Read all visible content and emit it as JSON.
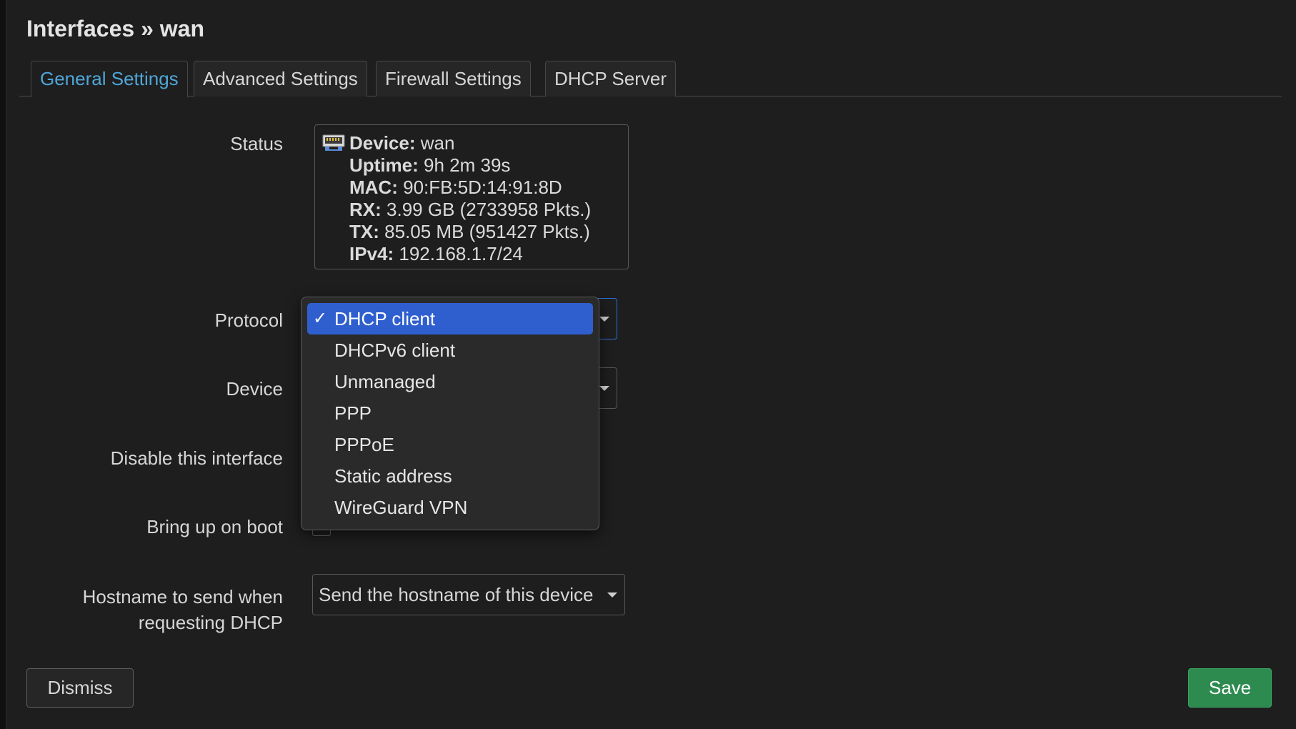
{
  "dialog": {
    "title": "Interfaces » wan"
  },
  "tabs": [
    {
      "label": "General Settings",
      "active": true
    },
    {
      "label": "Advanced Settings",
      "active": false
    },
    {
      "label": "Firewall Settings",
      "active": false
    },
    {
      "label": "DHCP Server",
      "active": false
    }
  ],
  "status": {
    "label": "Status",
    "icon": "ethernet-port-icon",
    "lines": [
      {
        "key": "Device:",
        "value": "wan"
      },
      {
        "key": "Uptime:",
        "value": "9h 2m 39s"
      },
      {
        "key": "MAC:",
        "value": "90:FB:5D:14:91:8D"
      },
      {
        "key": "RX:",
        "value": "3.99 GB (2733958 Pkts.)"
      },
      {
        "key": "TX:",
        "value": "85.05 MB (951427 Pkts.)"
      },
      {
        "key": "IPv4:",
        "value": "192.168.1.7/24"
      }
    ]
  },
  "protocol": {
    "label": "Protocol",
    "selected": "DHCP client",
    "options": [
      "DHCP client",
      "DHCPv6 client",
      "Unmanaged",
      "PPP",
      "PPPoE",
      "Static address",
      "WireGuard VPN"
    ],
    "check_mark": "✓"
  },
  "device": {
    "label": "Device"
  },
  "disable_interface": {
    "label": "Disable this interface"
  },
  "bring_up_on_boot": {
    "label": "Bring up on boot"
  },
  "hostname": {
    "label_line1": "Hostname to send when",
    "label_line2": "requesting DHCP",
    "value": "Send the hostname of this device"
  },
  "buttons": {
    "dismiss": "Dismiss",
    "save": "Save"
  },
  "colors": {
    "accent_tab": "#4fa6d8",
    "selected_option": "#2f5fcf",
    "save_button": "#2e8b50"
  }
}
